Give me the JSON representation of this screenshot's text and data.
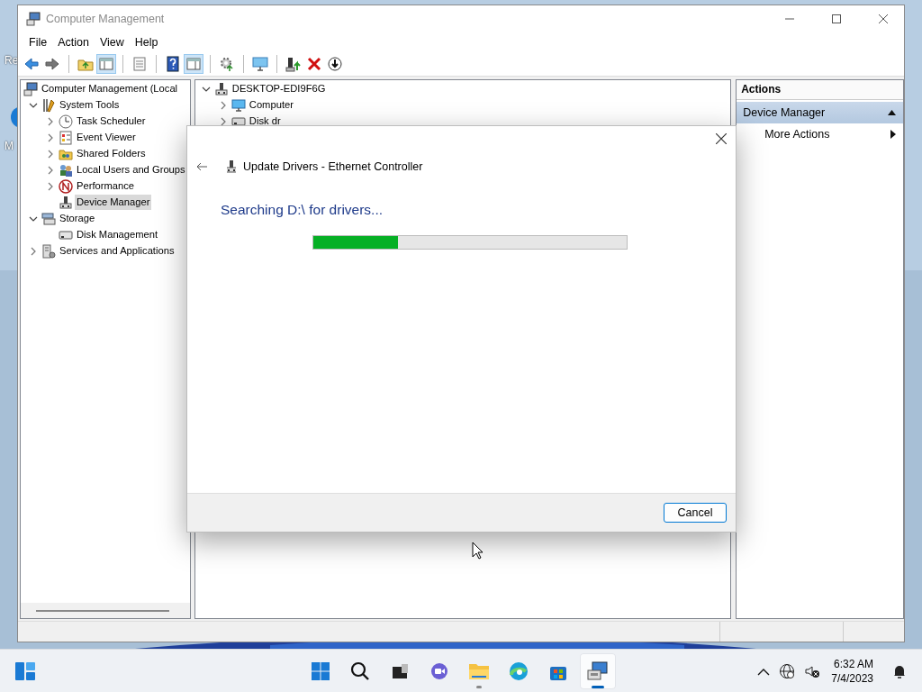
{
  "desktop_icons": [
    {
      "label": "Re"
    },
    {
      "label": "M",
      "kind": "browser"
    }
  ],
  "window": {
    "title": "Computer Management",
    "active": false
  },
  "menu": [
    "File",
    "Action",
    "View",
    "Help"
  ],
  "toolbar": [
    [
      {
        "kind": "back",
        "pressed": false
      },
      {
        "kind": "forward",
        "pressed": false
      }
    ],
    [
      {
        "kind": "up",
        "pressed": false
      },
      {
        "kind": "tree",
        "pressed": true
      }
    ],
    [
      {
        "kind": "properties",
        "pressed": false
      }
    ],
    [
      {
        "kind": "help",
        "pressed": false
      },
      {
        "kind": "actionpane",
        "pressed": true
      }
    ],
    [
      {
        "kind": "update",
        "pressed": false
      }
    ],
    [
      {
        "kind": "scan",
        "pressed": false
      }
    ],
    [
      {
        "kind": "enable",
        "pressed": false
      },
      {
        "kind": "uninstall",
        "pressed": false
      },
      {
        "kind": "download",
        "pressed": false
      }
    ]
  ],
  "navigation_tree": [
    {
      "label": "Computer Management (Local",
      "kind": "computer",
      "selected": false,
      "children": [
        {
          "label": "System Tools",
          "kind": "tools",
          "expanded": true,
          "selected": false,
          "children": [
            {
              "label": "Task Scheduler",
              "kind": "clock",
              "expanded": false,
              "selected": false
            },
            {
              "label": "Event Viewer",
              "kind": "log",
              "expanded": false,
              "selected": false
            },
            {
              "label": "Shared Folders",
              "kind": "share",
              "expanded": false,
              "selected": false
            },
            {
              "label": "Local Users and Groups",
              "kind": "users",
              "expanded": false,
              "selected": false
            },
            {
              "label": "Performance",
              "kind": "gauge",
              "expanded": false,
              "selected": false
            },
            {
              "label": "Device Manager",
              "kind": "device",
              "selected": true
            }
          ]
        },
        {
          "label": "Storage",
          "kind": "storage",
          "expanded": true,
          "selected": false,
          "children": [
            {
              "label": "Disk Management",
              "kind": "disk",
              "selected": false
            }
          ]
        },
        {
          "label": "Services and Applications",
          "kind": "services",
          "expanded": false,
          "selected": false
        }
      ]
    }
  ],
  "device_tree": [
    {
      "label": "DESKTOP-EDI9F6G",
      "kind": "device",
      "expanded": true,
      "children": [
        {
          "label": "Computer",
          "kind": "monitor",
          "expanded": false
        },
        {
          "label": "Disk dr",
          "kind": "disk",
          "expanded": false
        }
      ]
    }
  ],
  "actions": {
    "title": "Actions",
    "items": [
      {
        "label": "Device Manager",
        "kind": "group",
        "expanded": true
      },
      {
        "label": "More Actions",
        "kind": "submenu"
      }
    ]
  },
  "dialog": {
    "title": "Update Drivers - Ethernet Controller",
    "heading": "Searching D:\\ for drivers...",
    "progress": {
      "level": 0.27
    },
    "buttons": [
      "Cancel"
    ]
  },
  "taskbar": {
    "apps": [
      {
        "kind": "start",
        "running": false,
        "active": false
      },
      {
        "kind": "search",
        "running": false,
        "active": false
      },
      {
        "kind": "taskview",
        "running": false,
        "active": false
      },
      {
        "kind": "chat",
        "running": false,
        "active": false
      },
      {
        "kind": "explorer",
        "running": true,
        "active": false
      },
      {
        "kind": "edge",
        "running": false,
        "active": false
      },
      {
        "kind": "store",
        "running": false,
        "active": false
      },
      {
        "kind": "compmgmt",
        "running": true,
        "active": true
      }
    ],
    "time": "6:32 AM",
    "date": "7/4/2023"
  }
}
